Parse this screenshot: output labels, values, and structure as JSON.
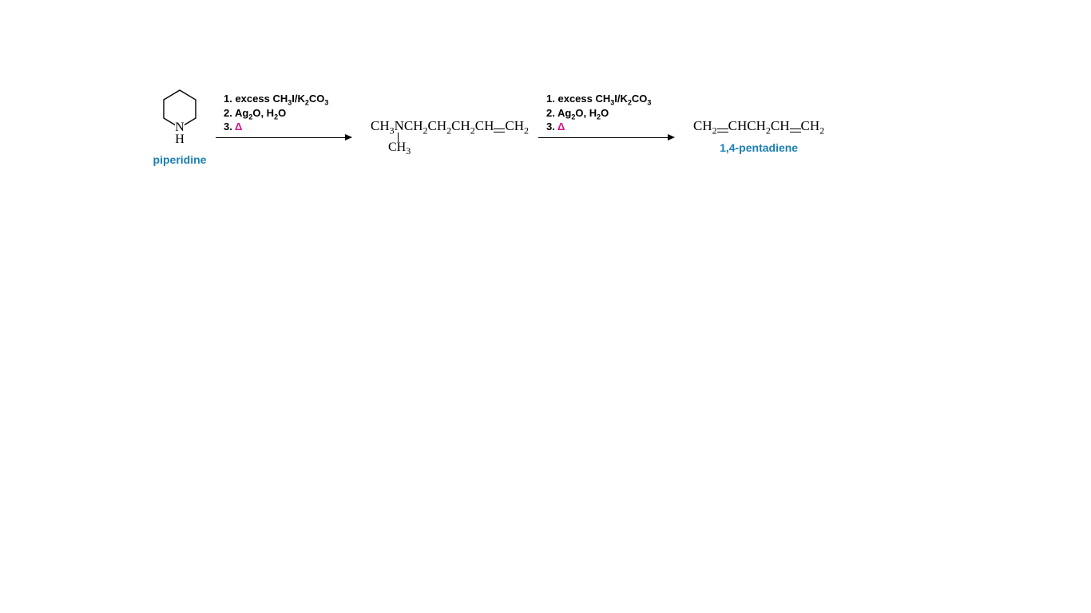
{
  "reactant": {
    "nh_label": "H",
    "name": "piperidine"
  },
  "steps1": {
    "line1_prefix": "1.  excess CH",
    "line1_mid": "I/K",
    "line1_end": "CO",
    "line2_prefix": "2.  Ag",
    "line2_mid": "O, H",
    "line2_end": "O",
    "line3_prefix": "3.  ",
    "delta": "Δ"
  },
  "intermediate": {
    "seg1": "CH",
    "seg2": "NCH",
    "seg3": "CH",
    "seg4": "CH",
    "seg5": "CH",
    "seg6": "CH",
    "nch3": "CH",
    "nch3_sub": "3"
  },
  "steps2": {
    "line1_prefix": "1.  excess CH",
    "line1_mid": "I/K",
    "line1_end": "CO",
    "line2_prefix": "2.  Ag",
    "line2_mid": "O, H",
    "line2_end": "O",
    "line3_prefix": "3.  ",
    "delta": "Δ"
  },
  "product": {
    "seg1": "CH",
    "seg2": "CHCH",
    "seg3": "CH",
    "seg4": "CH",
    "name": "1,4-pentadiene"
  },
  "subs": {
    "two": "2",
    "three": "3"
  }
}
